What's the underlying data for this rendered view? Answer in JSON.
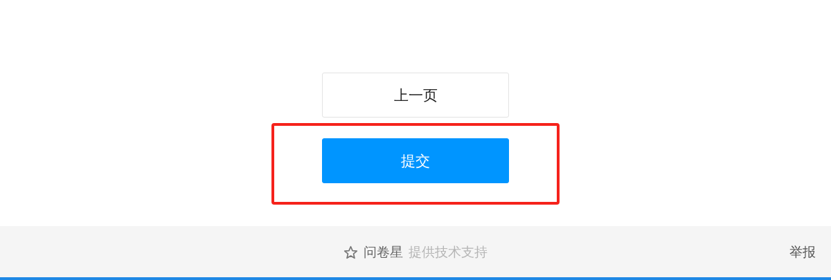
{
  "buttons": [
    {
      "label": "上一页",
      "kind": "secondary"
    },
    {
      "label": "提交",
      "kind": "primary",
      "highlighted": true
    }
  ],
  "footer": {
    "brand": "问卷星",
    "tagline": "提供技术支持",
    "report_link": "举报"
  }
}
